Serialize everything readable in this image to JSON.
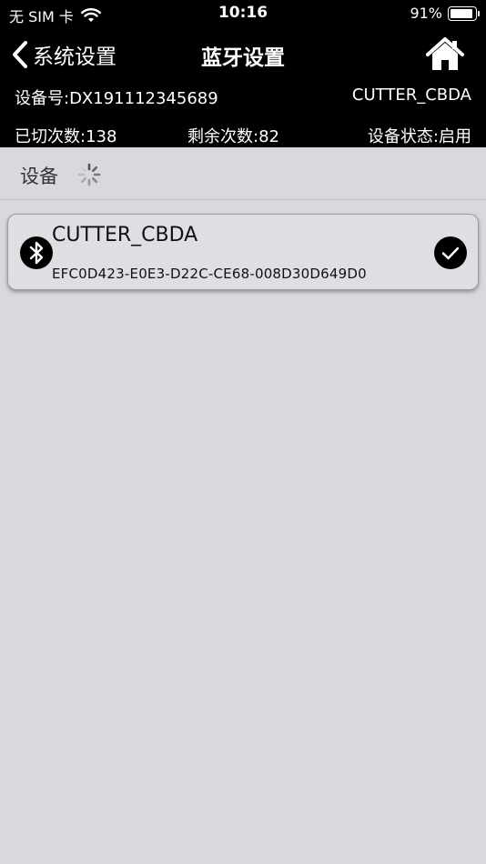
{
  "status_bar": {
    "carrier": "无 SIM 卡",
    "time": "10:16",
    "battery": "91%",
    "battery_level": 0.91
  },
  "nav": {
    "back_label": "系统设置",
    "title": "蓝牙设置",
    "home_icon": "home-icon"
  },
  "info": {
    "device_number": "设备号:DX191112345689",
    "device_name": "CUTTER_CBDA",
    "cut_count": "已切次数:138",
    "remaining_count": "剩余次数:82",
    "device_state": "设备状态:启用"
  },
  "section": {
    "label": "设备"
  },
  "devices": [
    {
      "name": "CUTTER_CBDA",
      "uuid": "EFC0D423-E0E3-D22C-CE68-008D30D649D0",
      "connected": true
    }
  ],
  "colors": {
    "header_bg": "#000000",
    "page_bg": "#d9d8de",
    "card_bg": "#dfdee3"
  }
}
